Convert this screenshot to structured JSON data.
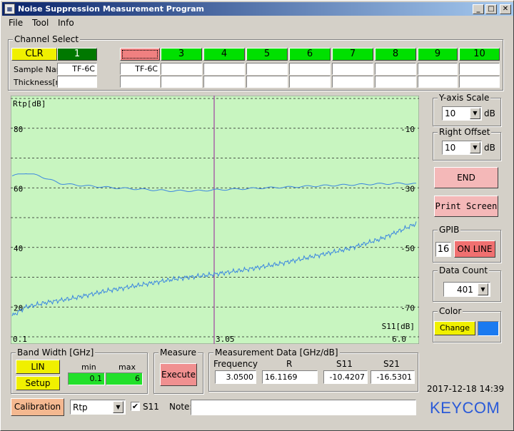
{
  "window": {
    "title": "Noise Suppression Measurement Program",
    "minimize": "_",
    "maximize": "□",
    "close": "✕",
    "icon": "app-icon"
  },
  "menu": [
    "File",
    "Tool",
    "Info"
  ],
  "channel_select": {
    "title": "Channel Select",
    "clr_label": "CLR",
    "channels": [
      "1",
      "",
      "3",
      "4",
      "5",
      "6",
      "7",
      "8",
      "9",
      "10"
    ],
    "channel_colors": [
      "#007800",
      "#f08080",
      "#00e000",
      "#00e000",
      "#00e000",
      "#00e000",
      "#00e000",
      "#00e000",
      "#00e000",
      "#00e000"
    ],
    "sample_name_label": "Sample Name",
    "thickness_label": "Thickness[mm]",
    "sample_names": [
      "TF-6C",
      "TF-6C",
      "",
      "",
      "",
      "",
      "",
      "",
      "",
      ""
    ],
    "thickness": [
      "",
      "",
      "",
      "",
      "",
      "",
      "",
      "",
      "",
      ""
    ]
  },
  "chart_data": {
    "type": "line",
    "ylabel_left": "Rtp[dB]",
    "ylabel_right": "S11[dB]",
    "left_ticks": [
      {
        "value": 80,
        "label": "80"
      },
      {
        "value": 60,
        "label": "60"
      },
      {
        "value": 40,
        "label": "40"
      },
      {
        "value": 20,
        "label": "20"
      }
    ],
    "right_ticks": [
      {
        "value": -10,
        "label": "-10"
      },
      {
        "value": -30,
        "label": "-30"
      },
      {
        "value": -50,
        "label": "-50"
      },
      {
        "value": -70,
        "label": "-70"
      }
    ],
    "xticks": [
      {
        "value": 0.1,
        "label": "0.1"
      },
      {
        "value": 3.05,
        "label": "3.05"
      },
      {
        "value": 6.0,
        "label": "6.0"
      }
    ],
    "xlim": [
      0.1,
      6.0
    ],
    "ylim_left": [
      10,
      90
    ],
    "ylim_right": [
      -80,
      0
    ],
    "marker_x": 3.05,
    "grid": true,
    "background": "#c8f5c0",
    "series": [
      {
        "axis": "left",
        "color": "#3a86e0",
        "x": [
          0.1,
          0.3,
          0.5,
          0.8,
          1.0,
          1.3,
          1.6,
          2.0,
          2.4,
          2.8,
          3.05,
          3.4,
          3.8,
          4.2,
          4.6,
          5.0,
          5.4,
          5.8,
          6.0
        ],
        "y": [
          64,
          65,
          64,
          61.5,
          61,
          60.5,
          60,
          59.5,
          59,
          59,
          59.3,
          59.6,
          60,
          60.3,
          60.7,
          61,
          61.3,
          61.5,
          61.3
        ]
      },
      {
        "axis": "right",
        "color": "#3a86e0",
        "x": [
          0.1,
          0.3,
          0.6,
          1.0,
          1.5,
          2.0,
          2.5,
          3.05,
          3.5,
          4.0,
          4.5,
          5.0,
          5.5,
          6.0
        ],
        "y": [
          -73,
          -70,
          -68.5,
          -67,
          -64.5,
          -62.5,
          -60.5,
          -59,
          -57.5,
          -55.5,
          -53,
          -50.5,
          -47,
          -42
        ]
      }
    ]
  },
  "yaxis_scale": {
    "title": "Y-axis Scale",
    "value": "10",
    "unit": "dB"
  },
  "right_offset": {
    "title": "Right Offset",
    "value": "10",
    "unit": "dB"
  },
  "end_button": "END",
  "print_button": "Print Screen",
  "gpib": {
    "title": "GPIB",
    "address": "16",
    "status": "ON LINE"
  },
  "data_count": {
    "title": "Data Count",
    "value": "401"
  },
  "color": {
    "title": "Color",
    "button": "Change",
    "swatch": "#1a7af0"
  },
  "bandwidth": {
    "title": "Band Width [GHz]",
    "lin": "LIN",
    "setup": "Setup",
    "min_label": "min",
    "max_label": "max",
    "min": "0.1",
    "max": "6"
  },
  "measure": {
    "title": "Measure",
    "execute": "Execute"
  },
  "measurement_data": {
    "title": "Measurement Data [GHz/dB]",
    "headers": [
      "Frequency",
      "R",
      "S11",
      "S21"
    ],
    "values": [
      "3.0500",
      "16.1169",
      "-10.4207",
      "-16.5301"
    ]
  },
  "datetime": "2017-12-18 14:39",
  "calibration": "Calibration",
  "mode_select": "Rtp",
  "s11_label": "S11",
  "s11_checked": true,
  "note_label": "Note:",
  "note_value": "",
  "brand": "KEYCOM"
}
